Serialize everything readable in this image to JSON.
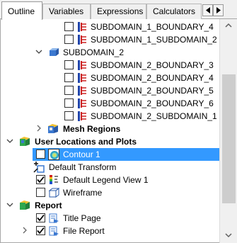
{
  "tabs": [
    {
      "label": "Outline"
    },
    {
      "label": "Variables"
    },
    {
      "label": "Expressions"
    },
    {
      "label": "Calculators"
    }
  ],
  "tree": {
    "subdomain_1_boundary_4": "SUBDOMAIN_1_BOUNDARY_4",
    "subdomain_1_subdomain_2": "SUBDOMAIN_1_SUBDOMAIN_2",
    "subdomain_2": "SUBDOMAIN_2",
    "subdomain_2_boundary_3": "SUBDOMAIN_2_BOUNDARY_3",
    "subdomain_2_boundary_4": "SUBDOMAIN_2_BOUNDARY_4",
    "subdomain_2_boundary_5": "SUBDOMAIN_2_BOUNDARY_5",
    "subdomain_2_boundary_6": "SUBDOMAIN_2_BOUNDARY_6",
    "subdomain_2_subdomain_1": "SUBDOMAIN_2_SUBDOMAIN_1",
    "mesh_regions": "Mesh Regions",
    "user_locations": "User Locations and Plots",
    "contour_1": "Contour 1",
    "default_transform": "Default Transform",
    "default_legend": "Default Legend View 1",
    "wireframe": "Wireframe",
    "report": "Report",
    "title_page": "Title Page",
    "file_report": "File Report"
  },
  "colors": {
    "selection": "#3399ff",
    "boundary_red": "#cc2222",
    "boundary_blue": "#2244aa"
  }
}
